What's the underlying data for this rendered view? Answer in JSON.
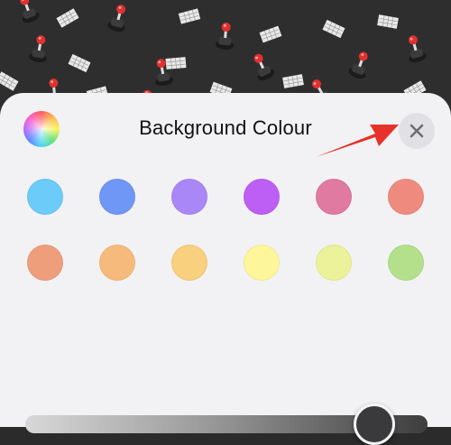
{
  "header": {
    "title": "Background Colour",
    "color_wheel_icon": "color-wheel-icon",
    "close_icon": "close-icon"
  },
  "annotation": {
    "arrow_color": "#e8312a"
  },
  "swatches": [
    [
      "#6ccbf8",
      "#6f97f5",
      "#a987f7",
      "#bd5ef4",
      "#e07aa1",
      "#ef8b7e"
    ],
    [
      "#ef9e7c",
      "#f6bb7c",
      "#f8d07e",
      "#fdf69b",
      "#ecf29a",
      "#b4df8b"
    ]
  ],
  "slider": {
    "value": 0.91
  }
}
